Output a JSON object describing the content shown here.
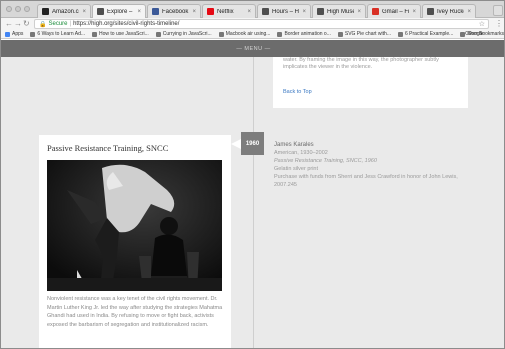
{
  "browser": {
    "tabs": [
      {
        "label": "Amazon.com",
        "favicon_color": "#222222",
        "active": false
      },
      {
        "label": "Explore – High",
        "favicon_color": "#4f4f4f",
        "active": true
      },
      {
        "label": "Facebook",
        "favicon_color": "#3b5998",
        "active": false
      },
      {
        "label": "Netflix",
        "favicon_color": "#e50914",
        "active": false
      },
      {
        "label": "Hours – High",
        "favicon_color": "#4f4f4f",
        "active": false
      },
      {
        "label": "High Museum",
        "favicon_color": "#4f4f4f",
        "active": false
      },
      {
        "label": "Gmail – Free",
        "favicon_color": "#d93025",
        "active": false
      },
      {
        "label": "Ivey Rucket",
        "favicon_color": "#4f4f4f",
        "active": false
      }
    ],
    "close_glyph": "×",
    "address": {
      "secure_label": "Secure",
      "separator": "|",
      "url": "https://high.org/sites/civil-rights-timeline/"
    },
    "bookmarks": [
      {
        "label": "Apps",
        "color": "#4285f4"
      },
      {
        "label": "6 Ways to Learn Ad...",
        "color": "#777777"
      },
      {
        "label": "How to use JavaScri...",
        "color": "#777777"
      },
      {
        "label": "Currying in JavaScri...",
        "color": "#777777"
      },
      {
        "label": "Macbook air using...",
        "color": "#777777"
      },
      {
        "label": "Border animation o...",
        "color": "#777777"
      },
      {
        "label": "SVG Pie chart with...",
        "color": "#777777"
      },
      {
        "label": "6 Practical Example...",
        "color": "#777777"
      },
      {
        "label": "Google",
        "color": "#777777"
      }
    ],
    "other_bookmarks": "Other Bookmarks"
  },
  "site": {
    "menu_label": "— MENU —"
  },
  "top_card": {
    "text": "water. By framing the image in this way, the photographer subtly implicates the viewer in the violence.",
    "back_to_top": "Back to Top"
  },
  "entry": {
    "year": "1960",
    "title": "Passive Resistance Training, SNCC",
    "caption": "Nonviolent resistance was a key tenet of the civil rights movement. Dr. Martin Luther King Jr. led the way after studying the strategies Mahatma Ghandi had used in India. By refusing to move or fight back, activists exposed the barbarism of segregation and institutionalized racism.",
    "artist": "James Karales",
    "nationality": "American, 1930–2002",
    "work_title": "Passive Resistance Training, SNCC, 1960",
    "medium": "Gelatin silver print",
    "credit": "Purchase with funds from Sherri and Jess Crawford in honor of John Lewis, 2007.245"
  },
  "colors": {
    "menu_bar": "#6c6c6c",
    "page_bg": "#eaeaea",
    "year_badge": "#7d7d7d",
    "link": "#3a78c2"
  }
}
